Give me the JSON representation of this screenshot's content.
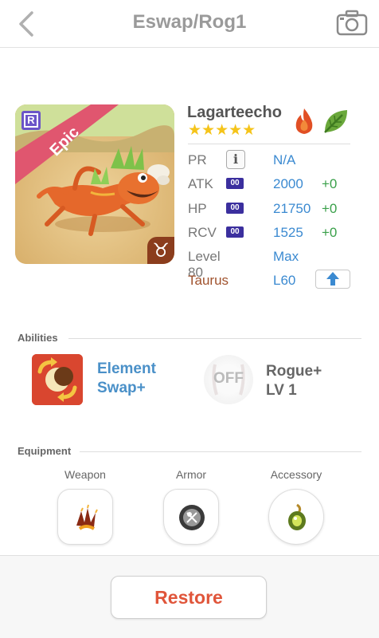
{
  "header": {
    "title": "Eswap/Rog1",
    "back_icon": "chevron-left-icon",
    "camera_icon": "camera-icon"
  },
  "monster": {
    "name": "Lagarteecho",
    "stars": "★★★★★",
    "rarity": "Epic",
    "rarity_badge": "R",
    "elements": [
      "fire",
      "wood"
    ],
    "zodiac_symbol": "♉"
  },
  "stats": {
    "pr": {
      "label": "PR",
      "value": "N/A",
      "info": "i"
    },
    "atk": {
      "label": "ATK",
      "badge": "00",
      "value": "2000",
      "bonus": "+0"
    },
    "hp": {
      "label": "HP",
      "badge": "00",
      "value": "21750",
      "bonus": "+0"
    },
    "rcv": {
      "label": "RCV",
      "badge": "00",
      "value": "1525",
      "bonus": "+0"
    },
    "level": {
      "label": "Level 80",
      "value": "Max"
    },
    "sign": {
      "label": "Taurus",
      "value": "L60"
    }
  },
  "abilities": {
    "label": "Abilities",
    "active": {
      "name_line1": "Element",
      "name_line2": "Swap+"
    },
    "passive": {
      "state": "OFF",
      "name_line1": "Rogue+",
      "name_line2": "LV 1"
    }
  },
  "equipment": {
    "label": "Equipment",
    "slots": [
      {
        "label": "Weapon"
      },
      {
        "label": "Armor"
      },
      {
        "label": "Accessory"
      }
    ]
  },
  "footer": {
    "restore_label": "Restore"
  },
  "colors": {
    "accent_blue": "#3b8ad1",
    "bonus_green": "#3aa04a",
    "restore_red": "#e0553a",
    "epic_ribbon": "#e0566f"
  }
}
